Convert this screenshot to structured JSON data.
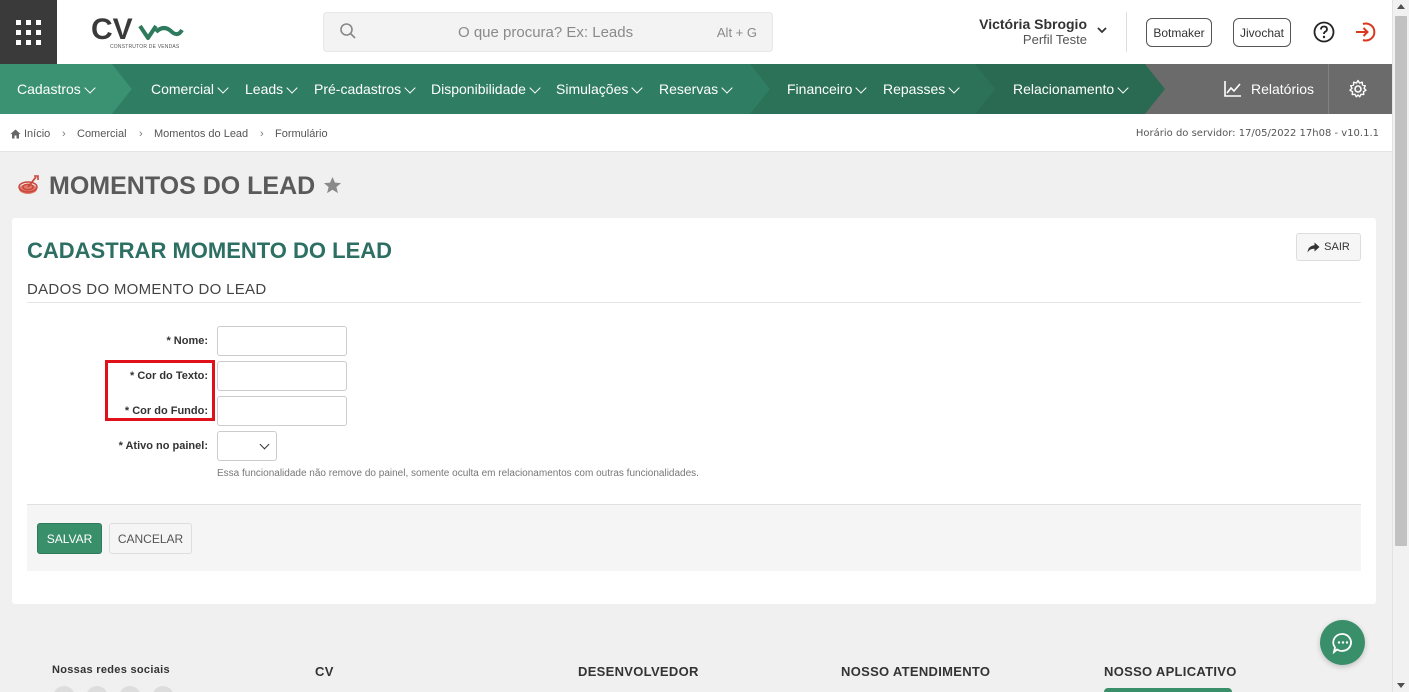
{
  "header": {
    "logo_text": "CV",
    "logo_subtitle": "CONSTRUTOR DE VENDAS",
    "search_placeholder": "O que procura? Ex: Leads",
    "search_shortcut": "Alt + G",
    "user_name": "Victória Sbrogio",
    "user_profile": "Perfil Teste",
    "botmaker_label": "Botmaker",
    "jivochat_label": "Jivochat"
  },
  "nav": {
    "items": [
      {
        "label": "Cadastros"
      },
      {
        "label": "Comercial"
      },
      {
        "label": "Leads"
      },
      {
        "label": "Pré-cadastros"
      },
      {
        "label": "Disponibilidade"
      },
      {
        "label": "Simulações"
      },
      {
        "label": "Reservas"
      },
      {
        "label": "Financeiro"
      },
      {
        "label": "Repasses"
      },
      {
        "label": "Relacionamento"
      }
    ],
    "reports_label": "Relatórios",
    "colors": {
      "seg1": "#3a9273",
      "seg2": "#2f7d62",
      "seg3": "#2b7258",
      "seg4": "#2a6a52",
      "right": "#6b6b6b"
    }
  },
  "breadcrumb": {
    "items": [
      "Início",
      "Comercial",
      "Momentos do Lead",
      "Formulário"
    ],
    "server_time": "Horário do servidor: 17/05/2022 17h08 - v10.1.1"
  },
  "page": {
    "title": "MOMENTOS DO LEAD",
    "form_title": "CADASTRAR MOMENTO DO LEAD",
    "exit_label": "SAIR",
    "section_title": "DADOS DO MOMENTO DO LEAD",
    "fields": {
      "nome_label": "* Nome:",
      "cor_texto_label": "* Cor do Texto:",
      "cor_fundo_label": "* Cor do Fundo:",
      "ativo_label": "* Ativo no painel:",
      "ativo_value": ""
    },
    "help_text": "Essa funcionalidade não remove do painel, somente oculta em relacionamentos com outras funcionalidades.",
    "save_label": "SALVAR",
    "cancel_label": "CANCELAR"
  },
  "footer": {
    "social_title": "Nossas redes sociais",
    "col_cv": "CV",
    "col_dev": "DESENVOLVEDOR",
    "col_support": "NOSSO ATENDIMENTO",
    "col_app": "NOSSO APLICATIVO"
  },
  "colors": {
    "brand_green": "#2e7a5d",
    "title_teal": "#2d6f63",
    "highlight_red": "#e0111a",
    "save_green": "#3a8f6b"
  }
}
